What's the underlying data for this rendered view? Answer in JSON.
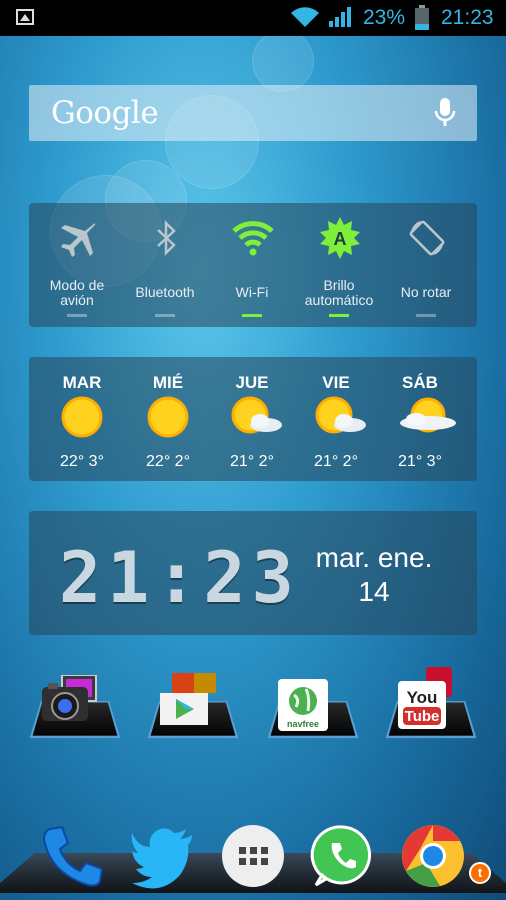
{
  "status_bar": {
    "battery": "23%",
    "time": "21:23",
    "icons": [
      "gallery-icon",
      "wifi-icon",
      "signal-icon",
      "battery-icon"
    ],
    "accent": "#33b5e5"
  },
  "search": {
    "logo": "Google",
    "icons": [
      "mic-icon"
    ]
  },
  "quick_settings": {
    "toggles": [
      {
        "label_line1": "Modo de",
        "label_line2": "avión",
        "icon": "airplane-icon",
        "on": false
      },
      {
        "label_line1": "Bluetooth",
        "label_line2": "",
        "icon": "bluetooth-icon",
        "on": false
      },
      {
        "label_line1": "Wi-Fi",
        "label_line2": "",
        "icon": "wifi-icon",
        "on": true
      },
      {
        "label_line1": "Brillo",
        "label_line2": "automático",
        "icon": "auto-brightness-icon",
        "on": true
      },
      {
        "label_line1": "No rotar",
        "label_line2": "",
        "icon": "rotation-icon",
        "on": false
      }
    ],
    "on_color": "#7ff03a"
  },
  "weather": {
    "days": [
      {
        "name": "MAR",
        "temps": "22° 3°",
        "icon": "sun-icon"
      },
      {
        "name": "MIÉ",
        "temps": "22° 2°",
        "icon": "sun-icon"
      },
      {
        "name": "JUE",
        "temps": "21° 2°",
        "icon": "partly-cloudy-icon"
      },
      {
        "name": "VIE",
        "temps": "21° 2°",
        "icon": "partly-cloudy-icon"
      },
      {
        "name": "SÁB",
        "temps": "21° 3°",
        "icon": "cloudy-sun-icon"
      }
    ]
  },
  "clock": {
    "time": "21:23",
    "date_line1": "mar. ene.",
    "date_line2": "14"
  },
  "apps": [
    {
      "name": "camera",
      "icon": "camera-icon"
    },
    {
      "name": "play-store",
      "icon": "play-store-icon"
    },
    {
      "name": "navfree",
      "icon": "navfree-icon",
      "text": "navfree"
    },
    {
      "name": "youtube",
      "icon": "youtube-icon",
      "text_line1": "You",
      "text_line2": "Tube"
    }
  ],
  "dock": [
    {
      "name": "phone",
      "icon": "phone-icon"
    },
    {
      "name": "twitter",
      "icon": "twitter-icon"
    },
    {
      "name": "app-drawer",
      "icon": "app-drawer-icon"
    },
    {
      "name": "whatsapp",
      "icon": "whatsapp-icon"
    },
    {
      "name": "chrome",
      "icon": "chrome-icon"
    }
  ],
  "notification_badge": "t"
}
